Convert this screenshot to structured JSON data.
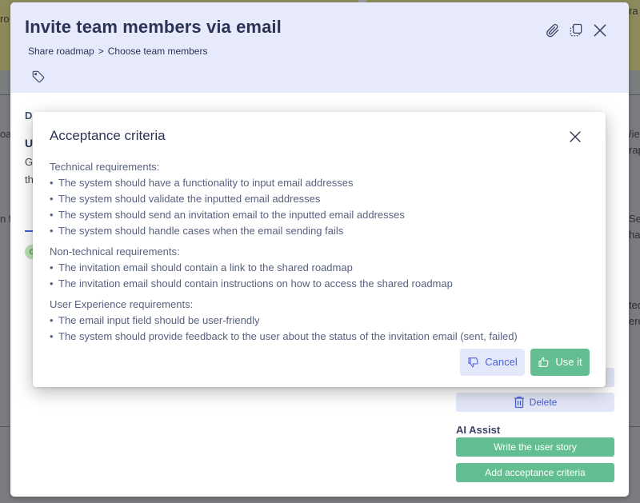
{
  "background": {
    "partial_texts": [
      "ro",
      "oa",
      "n fo",
      "ra",
      "/iew",
      "rap",
      "Set",
      "har",
      "ted",
      "ere"
    ]
  },
  "story_modal": {
    "title": "Invite team members via email",
    "breadcrumb": {
      "parent": "Share roadmap",
      "separator": ">",
      "current": "Choose team members"
    },
    "icons": {
      "tag": "tag-icon",
      "attach": "paperclip-icon",
      "duplicate": "copy-icon",
      "close": "close-icon"
    },
    "body": {
      "description_label_partial": "D",
      "user_story_label_partial": "U",
      "text_line1_partial": "G",
      "text_line2_partial": "th",
      "avatar_initial": "G"
    },
    "sidebar": {
      "delete_label": "Delete",
      "ai_assist_label": "AI Assist",
      "write_story_label": "Write the user story",
      "add_criteria_label": "Add acceptance criteria"
    }
  },
  "acceptance_dialog": {
    "title": "Acceptance criteria",
    "sections": [
      {
        "heading": "Technical requirements:",
        "items": [
          "The system should have a functionality to input email addresses",
          "The system should validate the inputted email addresses",
          "The system should send an invitation email to the inputted email addresses",
          "The system should handle cases when the email sending fails"
        ]
      },
      {
        "heading": "Non-technical requirements:",
        "items": [
          "The invitation email should contain a link to the shared roadmap",
          "The invitation email should contain instructions on how to access the shared roadmap"
        ]
      },
      {
        "heading": "User Experience requirements:",
        "items": [
          "The email input field should be user-friendly",
          "The system should provide feedback to the user about the status of the invitation email (sent, failed)"
        ]
      }
    ],
    "cancel_label": "Cancel",
    "use_label": "Use it"
  },
  "colors": {
    "header_bg": "#e6eafb",
    "title_text": "#2b3457",
    "accent_blue": "#4a63d9",
    "accent_green": "#63bf92"
  }
}
